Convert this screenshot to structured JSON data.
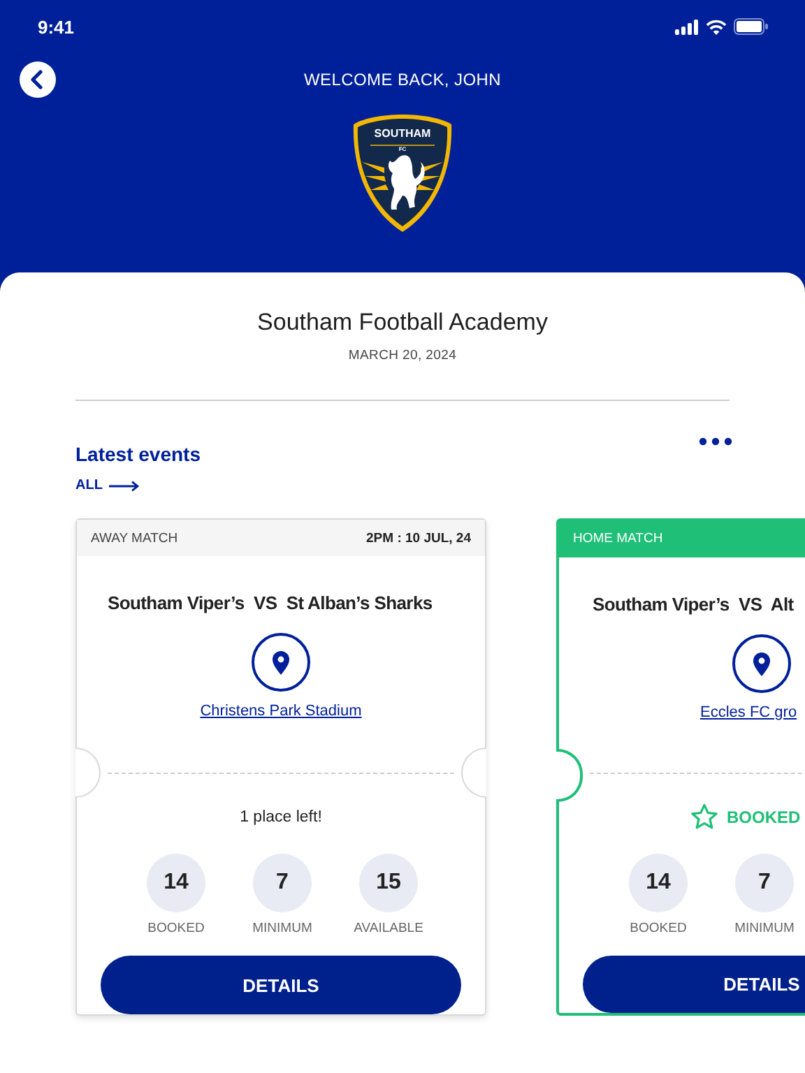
{
  "status_bar": {
    "time": "9:41"
  },
  "header": {
    "greeting": "WELCOME BACK, JOHN",
    "logo": {
      "name": "SOUTHAM",
      "sub": "FC"
    }
  },
  "academy": {
    "name": "Southam Football Academy",
    "date": "MARCH 20, 2024"
  },
  "events": {
    "title": "Latest events",
    "link": "ALL"
  },
  "cards": [
    {
      "kind": "away",
      "type": "AWAY MATCH",
      "time": "2PM : 10 JUL, 24",
      "title": "Southam Viper’s  VS  St Alban’s Sharks",
      "location": "Christens Park Stadium",
      "notice": {
        "kind": "text",
        "text": "1 place left!"
      },
      "stats": [
        {
          "value": "14",
          "label": "BOOKED"
        },
        {
          "value": "7",
          "label": "MINIMUM"
        },
        {
          "value": "15",
          "label": "AVAILABLE"
        }
      ],
      "button": "DETAILS"
    },
    {
      "kind": "home",
      "type": "HOME MATCH",
      "title": "Southam Viper’s  VS  Alt",
      "location": "Eccles FC gro",
      "notice": {
        "kind": "booked",
        "text": "BOOKED"
      },
      "stats": [
        {
          "value": "14",
          "label": "BOOKED"
        },
        {
          "value": "7",
          "label": "MINIMUM"
        }
      ],
      "button": "DETAILS"
    }
  ]
}
